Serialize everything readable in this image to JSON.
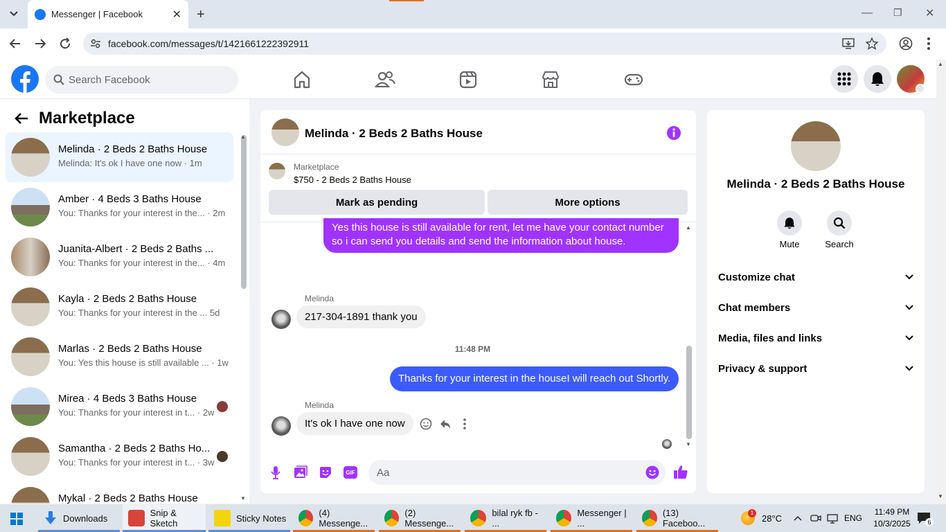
{
  "browser": {
    "tab_title": "Messenger | Facebook",
    "url": "facebook.com/messages/t/1421661222392911"
  },
  "fb_header": {
    "search_placeholder": "Search Facebook"
  },
  "marketplace": {
    "title": "Marketplace",
    "conversations": [
      {
        "name": "Melinda · 2 Beds 2 Baths House",
        "preview": "Melinda: It's ok I have one now · 1m",
        "active": true
      },
      {
        "name": "Amber · 4 Beds 3 Baths House",
        "preview": "You: Thanks for your interest in the... · 2m"
      },
      {
        "name": "Juanita-Albert · 2 Beds 2 Baths ...",
        "preview": "You: Thanks for your interest in the... · 4m"
      },
      {
        "name": "Kayla · 2 Beds 2 Baths House",
        "preview": "You: Thanks for your interest in the ... 5d"
      },
      {
        "name": "Marlas · 2 Beds 2 Baths House",
        "preview": "You: Yes this house is still available ... · 1w"
      },
      {
        "name": "Mirea · 4 Beds 3 Baths House",
        "preview": "You: Thanks for your interest in t... · 2w"
      },
      {
        "name": "Samantha · 2 Beds 2 Baths Ho...",
        "preview": "You: Thanks for your interest in t... · 3w"
      },
      {
        "name": "Mykal · 2 Beds 2 Baths House",
        "preview": ""
      }
    ]
  },
  "chat": {
    "title": "Melinda · 2 Beds 2 Baths House",
    "listing_source": "Marketplace",
    "listing_price_title": "$750 - 2 Beds 2 Baths House",
    "mark_pending_label": "Mark as pending",
    "more_options_label": "More options",
    "msg_me_1": "Yes this house is still available for rent, let me have your contact number so i can send you details and send the information about house.",
    "sender_name_1": "Melinda",
    "msg_them_1": "217-304-1891 thank you",
    "timestamp": "11:48 PM",
    "msg_me_2": "Thanks for your interest in the houseI will reach out Shortly.",
    "sender_name_2": "Melinda",
    "msg_them_2": "It's ok I have one now",
    "composer_placeholder": "Aa"
  },
  "info_panel": {
    "title": "Melinda · 2 Beds 2 Baths House",
    "mute_label": "Mute",
    "search_label": "Search",
    "sections": [
      "Customize chat",
      "Chat members",
      "Media, files and links",
      "Privacy & support"
    ]
  },
  "taskbar": {
    "items": [
      "Downloads",
      "Snip & Sketch",
      "Sticky Notes",
      "(4) Messenge...",
      "(2) Messenge...",
      "bilal ryk fb - ...",
      "Messenger | ...",
      "(13) Faceboo..."
    ],
    "temperature": "28°C",
    "language": "ENG",
    "time": "11:49 PM",
    "date": "10/3/2025",
    "notification_count": "6",
    "weather_badge": "1"
  },
  "colors": {
    "fb_blue": "#1877f2",
    "my_bubble": "#a033ff",
    "my_bubble_blue": "#3b5bfd"
  }
}
